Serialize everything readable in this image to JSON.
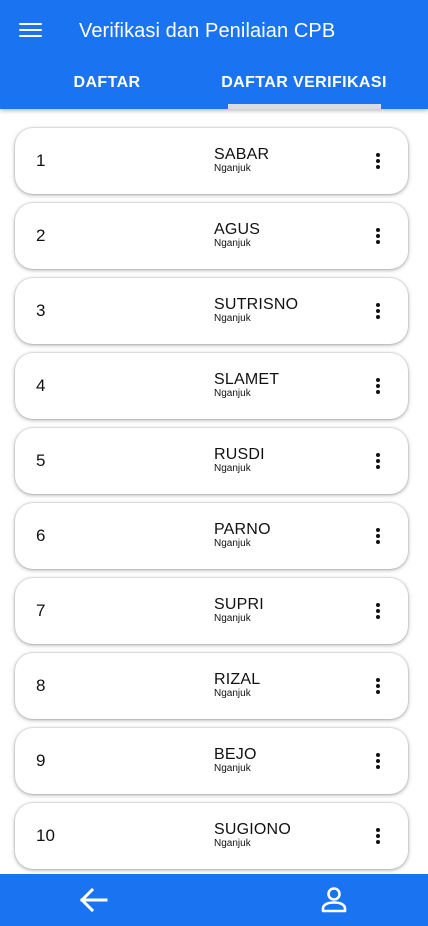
{
  "appbar": {
    "title": "Verifikasi dan Penilaian CPB",
    "menu_icon": "menu-icon"
  },
  "tabs": [
    {
      "label": "DAFTAR",
      "selected": false
    },
    {
      "label": "DAFTAR VERIFIKASI",
      "selected": true
    }
  ],
  "list": [
    {
      "number": "1",
      "name": "SABAR",
      "region": "Nganjuk"
    },
    {
      "number": "2",
      "name": "AGUS",
      "region": "Nganjuk"
    },
    {
      "number": "3",
      "name": "SUTRISNO",
      "region": "Nganjuk"
    },
    {
      "number": "4",
      "name": "SLAMET",
      "region": "Nganjuk"
    },
    {
      "number": "5",
      "name": "RUSDI",
      "region": "Nganjuk"
    },
    {
      "number": "6",
      "name": "PARNO",
      "region": "Nganjuk"
    },
    {
      "number": "7",
      "name": "SUPRI",
      "region": "Nganjuk"
    },
    {
      "number": "8",
      "name": "RIZAL",
      "region": "Nganjuk"
    },
    {
      "number": "9",
      "name": "BEJO",
      "region": "Nganjuk"
    },
    {
      "number": "10",
      "name": "SUGIONO",
      "region": "Nganjuk"
    }
  ],
  "bottombar": {
    "back_icon": "arrow-left-icon",
    "profile_icon": "person-icon"
  },
  "colors": {
    "primary": "#1a73f0",
    "tab_indicator": "#d8dde3",
    "card": "#ffffff"
  }
}
